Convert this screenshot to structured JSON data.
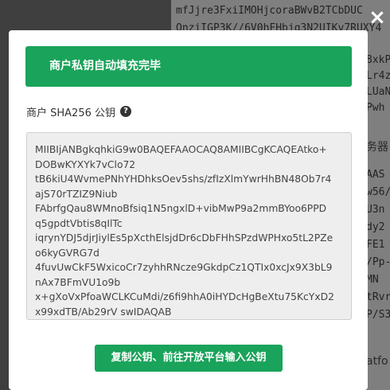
{
  "background": {
    "lines": [
      "mfJjre3FxiIMOHjcoraBWvB2TCbDUC",
      "QnziIGP3K//6V0hFHbjq3N2UIKv7RUXY4",
      "8xkP",
      "Lr4z",
      "LUaN",
      "Pwh",
      "务器",
      "AAS",
      "w56/",
      "U3n",
      "dy2",
      "FE1",
      "/Pp-",
      "MN",
      "tRvr",
      "P/S3",
      "atfo"
    ]
  },
  "close": {
    "icon": "close-icon",
    "label": "×"
  },
  "modal": {
    "alert_text": "商户私钥自动填充完毕",
    "label": "商户 SHA256 公钥",
    "help_icon_text": "?",
    "public_key": "MIIBIjANBgkqhkiG9w0BAQEFAAOCAQ8AMIIBCgKCAQEAtko+\nDOBwKYXYk7vClo72\ntB6kiU4WvmePNhYHDhksOev5shs/zfIzXlmYwrHhBN48Ob7r4\najS70rTZIZ9Niub\nFAbrfgQau8WMnoBfsiq1N5ngxlD+vibMwP9a2mmBYoo6PPD\nq5gpdtVbtis8qIlTc\niqrynYDJ5djrJiylEs5pXcthElsjdDr6cDbFHhSPzdWPHxo5tL2PZe\no6kyGVRG7d\n4fuvUwCkF5WxicoCr7zyhhRNcze9GkdpCz1QTIx0xcJx9X3bL9\nnAx7BFmVU1o9b\nx+gXoVxPfoaWCLKCuMdi/z6fi9hhA0iHYDcHgBeXtu75KcYxD2\nx99xdTB/Ab29rV swIDAQAB",
    "copy_button": "复制公钥、前往开放平台输入公钥"
  },
  "colors": {
    "accent": "#1aa35a",
    "key_box_bg": "#eeeeee"
  }
}
